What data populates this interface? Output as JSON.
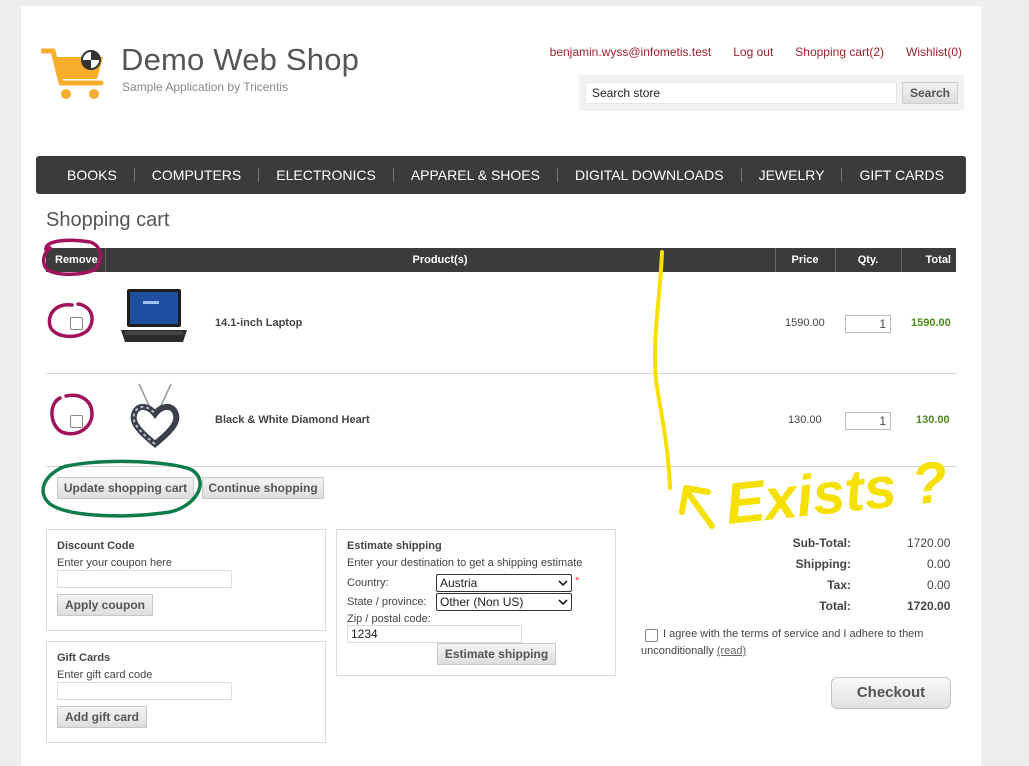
{
  "header": {
    "brand_title": "Demo Web Shop",
    "brand_subtitle": "Sample Application by Tricentis",
    "user_email": "benjamin.wyss@infometis.test",
    "logout": "Log out",
    "shopping_cart": "Shopping cart(2)",
    "wishlist": "Wishlist(0)",
    "search_value": "Search store",
    "search_button": "Search"
  },
  "nav": [
    "BOOKS",
    "COMPUTERS",
    "ELECTRONICS",
    "APPAREL & SHOES",
    "DIGITAL DOWNLOADS",
    "JEWELRY",
    "GIFT CARDS"
  ],
  "cart": {
    "title": "Shopping cart",
    "columns": {
      "remove": "Remove",
      "product": "Product(s)",
      "price": "Price",
      "qty": "Qty.",
      "total": "Total"
    },
    "items": [
      {
        "name": "14.1-inch Laptop",
        "price": "1590.00",
        "qty": "1",
        "total": "1590.00",
        "image": "laptop-image"
      },
      {
        "name": "Black & White Diamond Heart",
        "price": "130.00",
        "qty": "1",
        "total": "130.00",
        "image": "heart-pendant-image"
      }
    ],
    "update_button": "Update shopping cart",
    "continue_button": "Continue shopping"
  },
  "discount": {
    "title": "Discount Code",
    "hint": "Enter your coupon here",
    "button": "Apply coupon"
  },
  "gift": {
    "title": "Gift Cards",
    "hint": "Enter gift card code",
    "button": "Add gift card"
  },
  "shipping": {
    "title": "Estimate shipping",
    "hint": "Enter your destination to get a shipping estimate",
    "country_label": "Country:",
    "country_value": "Austria",
    "required_mark": "*",
    "state_label": "State / province:",
    "state_value": "Other (Non US)",
    "zip_label": "Zip / postal code:",
    "zip_value": "1234",
    "button": "Estimate shipping"
  },
  "totals": {
    "subtotal_label": "Sub-Total:",
    "subtotal": "1720.00",
    "shipping_label": "Shipping:",
    "shipping": "0.00",
    "tax_label": "Tax:",
    "tax": "0.00",
    "total_label": "Total:",
    "total": "1720.00"
  },
  "terms": {
    "text": "I agree with the terms of service and I adhere to them unconditionally",
    "link": "(read)"
  },
  "checkout": "Checkout",
  "annotation": {
    "text": "Exists ?",
    "color": "#f5e000"
  },
  "colors": {
    "link_red": "#a01f2a",
    "nav_bg": "#3b3b3b",
    "total_green": "#4a8a1a",
    "logo_orange": "#f9ad2d",
    "circle_magenta": "#a0135a",
    "circle_green": "#0f7a4a"
  }
}
